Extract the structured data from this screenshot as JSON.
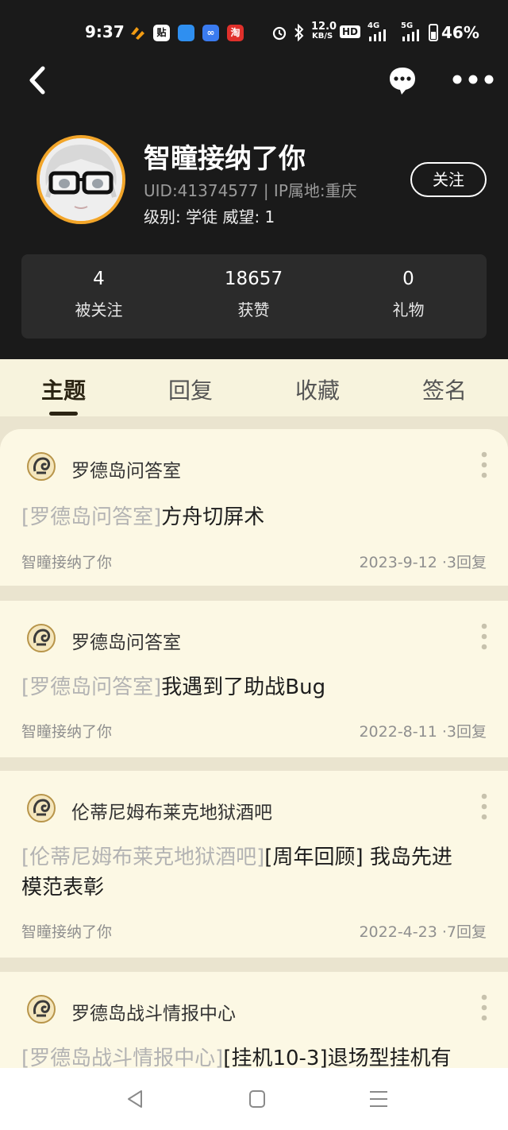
{
  "status_bar": {
    "time": "9:37",
    "app_icons": [
      "huawei-icon",
      "tieba-icon",
      "weather-icon",
      "infinity-icon",
      "taobao-icon"
    ],
    "net_speed_value": "12.0",
    "net_speed_unit": "KB/S",
    "hd_label": "HD",
    "net_4g": "4G",
    "net_5g": "5G",
    "battery": "46%"
  },
  "nav": {
    "back_icon": "chevron-left-icon",
    "message_icon": "chat-bubble-icon",
    "more_icon": "more-dots-icon"
  },
  "profile": {
    "name": "智瞳接纳了你",
    "uid_line": "UID:41374577 | IP属地:重庆",
    "rank_line": "级别: 学徒  威望: 1",
    "follow_label": "关注",
    "avatar_border_color": "#f2a529"
  },
  "stats": [
    {
      "value": "4",
      "label": "被关注"
    },
    {
      "value": "18657",
      "label": "获赞"
    },
    {
      "value": "0",
      "label": "礼物"
    }
  ],
  "tabs": [
    {
      "label": "主题",
      "active": true
    },
    {
      "label": "回复",
      "active": false
    },
    {
      "label": "收藏",
      "active": false
    },
    {
      "label": "签名",
      "active": false
    }
  ],
  "posts": [
    {
      "forum": "罗德岛问答室",
      "tag": "[罗德岛问答室]",
      "title_line1": "方舟切屏术",
      "title_line2": "",
      "author": "智瞳接纳了你",
      "date": "2023-9-12",
      "replies": "·3回复"
    },
    {
      "forum": "罗德岛问答室",
      "tag": "[罗德岛问答室]",
      "title_line1": "我遇到了助战Bug",
      "title_line2": "",
      "author": "智瞳接纳了你",
      "date": "2022-8-11",
      "replies": "·3回复"
    },
    {
      "forum": "伦蒂尼姆布莱克地狱酒吧",
      "tag": "[伦蒂尼姆布莱克地狱酒吧]",
      "title_line1": "[周年回顾] 我岛先进",
      "title_line2": "模范表彰",
      "author": "智瞳接纳了你",
      "date": "2022-4-23",
      "replies": "·7回复"
    },
    {
      "forum": "罗德岛战斗情报中心",
      "tag": "[罗德岛战斗情报中心]",
      "title_line1": "[挂机10-3]退场型挂机有",
      "title_line2": "",
      "author": "",
      "date": "",
      "replies": ""
    }
  ],
  "system_nav": {
    "back_icon": "triangle-back-icon",
    "home_icon": "square-home-icon",
    "recents_icon": "menu-lines-icon"
  },
  "colors": {
    "header_bg": "#1a1a1a",
    "card_bg": "#fcf8e4",
    "separator_bg": "#eae4cf",
    "tag_gray": "#b3b3b3",
    "accent_orange": "#f2a529"
  }
}
